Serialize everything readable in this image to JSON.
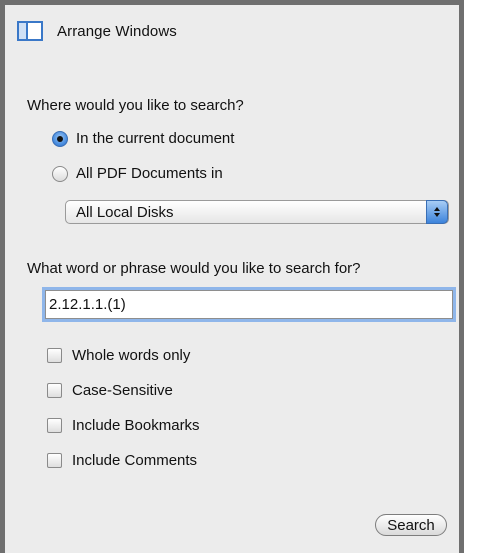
{
  "arrange": {
    "icon": "arrange-windows-icon",
    "label": "Arrange Windows"
  },
  "scope": {
    "question": "Where would you like to search?",
    "options": [
      {
        "label": "In the current document",
        "selected": true
      },
      {
        "label": "All PDF Documents in",
        "selected": false
      }
    ],
    "location_dropdown": {
      "value": "All Local Disks"
    }
  },
  "query": {
    "question": "What word or phrase would you like to search for?",
    "value": "2.12.1.1.(1)"
  },
  "options": {
    "checkboxes": [
      {
        "label": "Whole words only",
        "checked": false
      },
      {
        "label": "Case-Sensitive",
        "checked": false
      },
      {
        "label": "Include Bookmarks",
        "checked": false
      },
      {
        "label": "Include Comments",
        "checked": false
      }
    ]
  },
  "actions": {
    "search_label": "Search"
  },
  "colors": {
    "panel_background": "#ececec",
    "panel_border": "#6f6f6f",
    "accent_blue": "#4b8fe0",
    "focus_ring": "#8fb6ea"
  }
}
